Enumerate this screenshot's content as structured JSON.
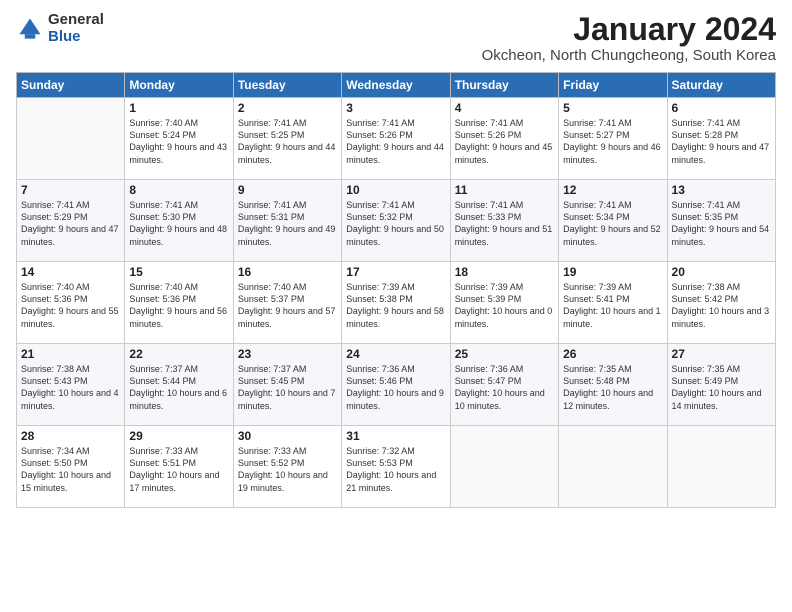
{
  "logo": {
    "general": "General",
    "blue": "Blue"
  },
  "header": {
    "month": "January 2024",
    "location": "Okcheon, North Chungcheong, South Korea"
  },
  "weekdays": [
    "Sunday",
    "Monday",
    "Tuesday",
    "Wednesday",
    "Thursday",
    "Friday",
    "Saturday"
  ],
  "weeks": [
    [
      {
        "day": "",
        "sunrise": "",
        "sunset": "",
        "daylight": ""
      },
      {
        "day": "1",
        "sunrise": "Sunrise: 7:40 AM",
        "sunset": "Sunset: 5:24 PM",
        "daylight": "Daylight: 9 hours and 43 minutes."
      },
      {
        "day": "2",
        "sunrise": "Sunrise: 7:41 AM",
        "sunset": "Sunset: 5:25 PM",
        "daylight": "Daylight: 9 hours and 44 minutes."
      },
      {
        "day": "3",
        "sunrise": "Sunrise: 7:41 AM",
        "sunset": "Sunset: 5:26 PM",
        "daylight": "Daylight: 9 hours and 44 minutes."
      },
      {
        "day": "4",
        "sunrise": "Sunrise: 7:41 AM",
        "sunset": "Sunset: 5:26 PM",
        "daylight": "Daylight: 9 hours and 45 minutes."
      },
      {
        "day": "5",
        "sunrise": "Sunrise: 7:41 AM",
        "sunset": "Sunset: 5:27 PM",
        "daylight": "Daylight: 9 hours and 46 minutes."
      },
      {
        "day": "6",
        "sunrise": "Sunrise: 7:41 AM",
        "sunset": "Sunset: 5:28 PM",
        "daylight": "Daylight: 9 hours and 47 minutes."
      }
    ],
    [
      {
        "day": "7",
        "sunrise": "Sunrise: 7:41 AM",
        "sunset": "Sunset: 5:29 PM",
        "daylight": "Daylight: 9 hours and 47 minutes."
      },
      {
        "day": "8",
        "sunrise": "Sunrise: 7:41 AM",
        "sunset": "Sunset: 5:30 PM",
        "daylight": "Daylight: 9 hours and 48 minutes."
      },
      {
        "day": "9",
        "sunrise": "Sunrise: 7:41 AM",
        "sunset": "Sunset: 5:31 PM",
        "daylight": "Daylight: 9 hours and 49 minutes."
      },
      {
        "day": "10",
        "sunrise": "Sunrise: 7:41 AM",
        "sunset": "Sunset: 5:32 PM",
        "daylight": "Daylight: 9 hours and 50 minutes."
      },
      {
        "day": "11",
        "sunrise": "Sunrise: 7:41 AM",
        "sunset": "Sunset: 5:33 PM",
        "daylight": "Daylight: 9 hours and 51 minutes."
      },
      {
        "day": "12",
        "sunrise": "Sunrise: 7:41 AM",
        "sunset": "Sunset: 5:34 PM",
        "daylight": "Daylight: 9 hours and 52 minutes."
      },
      {
        "day": "13",
        "sunrise": "Sunrise: 7:41 AM",
        "sunset": "Sunset: 5:35 PM",
        "daylight": "Daylight: 9 hours and 54 minutes."
      }
    ],
    [
      {
        "day": "14",
        "sunrise": "Sunrise: 7:40 AM",
        "sunset": "Sunset: 5:36 PM",
        "daylight": "Daylight: 9 hours and 55 minutes."
      },
      {
        "day": "15",
        "sunrise": "Sunrise: 7:40 AM",
        "sunset": "Sunset: 5:36 PM",
        "daylight": "Daylight: 9 hours and 56 minutes."
      },
      {
        "day": "16",
        "sunrise": "Sunrise: 7:40 AM",
        "sunset": "Sunset: 5:37 PM",
        "daylight": "Daylight: 9 hours and 57 minutes."
      },
      {
        "day": "17",
        "sunrise": "Sunrise: 7:39 AM",
        "sunset": "Sunset: 5:38 PM",
        "daylight": "Daylight: 9 hours and 58 minutes."
      },
      {
        "day": "18",
        "sunrise": "Sunrise: 7:39 AM",
        "sunset": "Sunset: 5:39 PM",
        "daylight": "Daylight: 10 hours and 0 minutes."
      },
      {
        "day": "19",
        "sunrise": "Sunrise: 7:39 AM",
        "sunset": "Sunset: 5:41 PM",
        "daylight": "Daylight: 10 hours and 1 minute."
      },
      {
        "day": "20",
        "sunrise": "Sunrise: 7:38 AM",
        "sunset": "Sunset: 5:42 PM",
        "daylight": "Daylight: 10 hours and 3 minutes."
      }
    ],
    [
      {
        "day": "21",
        "sunrise": "Sunrise: 7:38 AM",
        "sunset": "Sunset: 5:43 PM",
        "daylight": "Daylight: 10 hours and 4 minutes."
      },
      {
        "day": "22",
        "sunrise": "Sunrise: 7:37 AM",
        "sunset": "Sunset: 5:44 PM",
        "daylight": "Daylight: 10 hours and 6 minutes."
      },
      {
        "day": "23",
        "sunrise": "Sunrise: 7:37 AM",
        "sunset": "Sunset: 5:45 PM",
        "daylight": "Daylight: 10 hours and 7 minutes."
      },
      {
        "day": "24",
        "sunrise": "Sunrise: 7:36 AM",
        "sunset": "Sunset: 5:46 PM",
        "daylight": "Daylight: 10 hours and 9 minutes."
      },
      {
        "day": "25",
        "sunrise": "Sunrise: 7:36 AM",
        "sunset": "Sunset: 5:47 PM",
        "daylight": "Daylight: 10 hours and 10 minutes."
      },
      {
        "day": "26",
        "sunrise": "Sunrise: 7:35 AM",
        "sunset": "Sunset: 5:48 PM",
        "daylight": "Daylight: 10 hours and 12 minutes."
      },
      {
        "day": "27",
        "sunrise": "Sunrise: 7:35 AM",
        "sunset": "Sunset: 5:49 PM",
        "daylight": "Daylight: 10 hours and 14 minutes."
      }
    ],
    [
      {
        "day": "28",
        "sunrise": "Sunrise: 7:34 AM",
        "sunset": "Sunset: 5:50 PM",
        "daylight": "Daylight: 10 hours and 15 minutes."
      },
      {
        "day": "29",
        "sunrise": "Sunrise: 7:33 AM",
        "sunset": "Sunset: 5:51 PM",
        "daylight": "Daylight: 10 hours and 17 minutes."
      },
      {
        "day": "30",
        "sunrise": "Sunrise: 7:33 AM",
        "sunset": "Sunset: 5:52 PM",
        "daylight": "Daylight: 10 hours and 19 minutes."
      },
      {
        "day": "31",
        "sunrise": "Sunrise: 7:32 AM",
        "sunset": "Sunset: 5:53 PM",
        "daylight": "Daylight: 10 hours and 21 minutes."
      },
      {
        "day": "",
        "sunrise": "",
        "sunset": "",
        "daylight": ""
      },
      {
        "day": "",
        "sunrise": "",
        "sunset": "",
        "daylight": ""
      },
      {
        "day": "",
        "sunrise": "",
        "sunset": "",
        "daylight": ""
      }
    ]
  ]
}
